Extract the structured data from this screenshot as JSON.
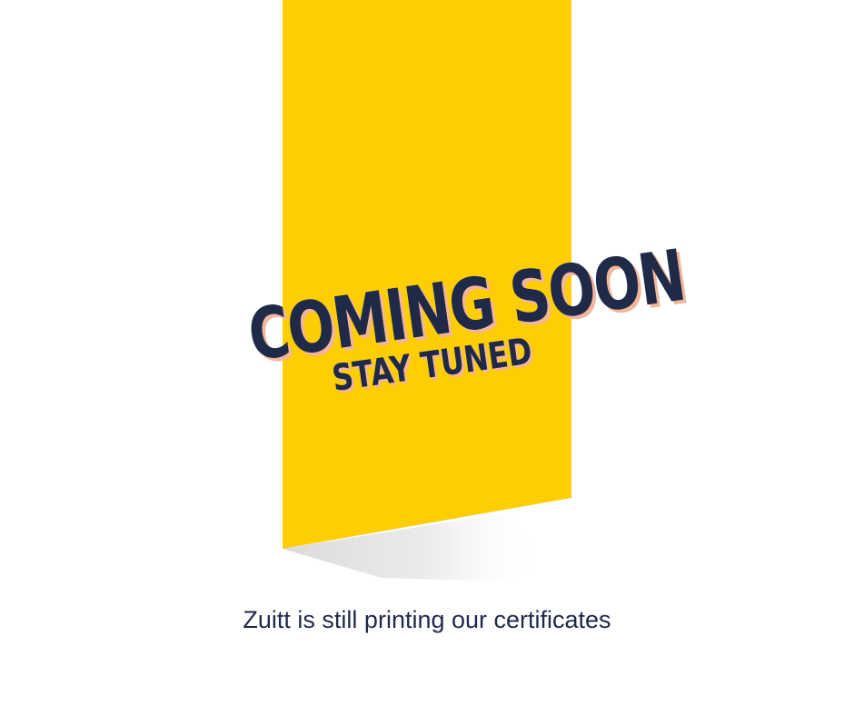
{
  "banner": {
    "color": "#fecd02",
    "shadow_color": "#d9d9d9"
  },
  "headline": {
    "title": "COMING SOON",
    "subtitle": "STAY TUNED",
    "text_color": "#1f2a48",
    "shadow_color": "#f2b69c"
  },
  "caption": {
    "text": "Zuitt is still printing our certificates"
  }
}
